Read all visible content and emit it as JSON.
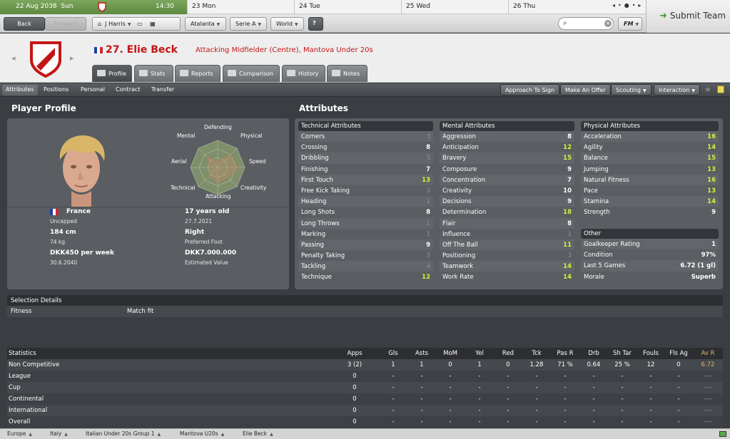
{
  "calendar": {
    "today_date": "22 Aug 2038",
    "today_day": "Sun",
    "time": "14:30",
    "days": [
      {
        "date": "23",
        "day": "Mon"
      },
      {
        "date": "24",
        "day": "Tue"
      },
      {
        "date": "25",
        "day": "Wed"
      },
      {
        "date": "26",
        "day": "Thu"
      }
    ]
  },
  "submit_team": "Submit Team",
  "nav": {
    "back": "Back",
    "forward": "Forward",
    "manager": "J Harris",
    "club": "Atalanta",
    "league": "Serie A",
    "world": "World",
    "fm": "FM"
  },
  "player": {
    "number_name": "27. Elie Beck",
    "role": "Attacking Midfielder (Centre), Mantova Under 20s",
    "header_tabs": [
      "Profile",
      "Stats",
      "Reports",
      "Comparison",
      "History",
      "Notes"
    ]
  },
  "subtabs": [
    "Attributes",
    "Positions",
    "Personal",
    "Contract",
    "Transfer"
  ],
  "actions": {
    "approach": "Approach To Sign",
    "offer": "Make An Offer",
    "scouting": "Scouting",
    "interaction": "Interaction"
  },
  "profile": {
    "title": "Player Profile",
    "nationality": "France",
    "caps": "Uncapped",
    "age": "17 years old",
    "dob": "27.7.2021",
    "height": "184 cm",
    "weight": "74 kg",
    "foot": "Right",
    "foot_label": "Preferred Foot",
    "wage": "DKK450 per week",
    "contract_end": "30.6.2040",
    "value": "DKK7.000.000",
    "value_label": "Estimated Value",
    "radar": {
      "defending": "Defending",
      "physical": "Physical",
      "speed": "Speed",
      "creativity": "Creativity",
      "attacking": "Attacking",
      "technical": "Technical",
      "aerial": "Aerial",
      "mental": "Mental"
    }
  },
  "attributes": {
    "title": "Attributes",
    "technical": {
      "header": "Technical Attributes",
      "rows": [
        [
          "Corners",
          "3"
        ],
        [
          "Crossing",
          "8"
        ],
        [
          "Dribbling",
          "5"
        ],
        [
          "Finishing",
          "7"
        ],
        [
          "First Touch",
          "13"
        ],
        [
          "Free Kick Taking",
          "3"
        ],
        [
          "Heading",
          "1"
        ],
        [
          "Long Shots",
          "8"
        ],
        [
          "Long Throws",
          "1"
        ],
        [
          "Marking",
          "1"
        ],
        [
          "Passing",
          "9"
        ],
        [
          "Penalty Taking",
          "5"
        ],
        [
          "Tackling",
          "4"
        ],
        [
          "Technique",
          "12"
        ]
      ]
    },
    "mental": {
      "header": "Mental Attributes",
      "rows": [
        [
          "Aggression",
          "8"
        ],
        [
          "Anticipation",
          "12"
        ],
        [
          "Bravery",
          "15"
        ],
        [
          "Composure",
          "9"
        ],
        [
          "Concentration",
          "7"
        ],
        [
          "Creativity",
          "10"
        ],
        [
          "Decisions",
          "9"
        ],
        [
          "Determination",
          "18"
        ],
        [
          "Flair",
          "8"
        ],
        [
          "Influence",
          "1"
        ],
        [
          "Off The Ball",
          "11"
        ],
        [
          "Positioning",
          "3"
        ],
        [
          "Teamwork",
          "14"
        ],
        [
          "Work Rate",
          "14"
        ]
      ]
    },
    "physical": {
      "header": "Physical Attributes",
      "rows": [
        [
          "Acceleration",
          "16"
        ],
        [
          "Agility",
          "14"
        ],
        [
          "Balance",
          "15"
        ],
        [
          "Jumping",
          "13"
        ],
        [
          "Natural Fitness",
          "16"
        ],
        [
          "Pace",
          "13"
        ],
        [
          "Stamina",
          "14"
        ],
        [
          "Strength",
          "9"
        ]
      ]
    },
    "other": {
      "header": "Other",
      "rows": [
        [
          "Goalkeeper Rating",
          "1"
        ],
        [
          "Condition",
          "97%"
        ],
        [
          "Last 5 Games",
          "6.72 (1 gl)"
        ],
        [
          "Morale",
          "Superb"
        ]
      ]
    }
  },
  "selection": {
    "title": "Selection Details",
    "fitness_label": "Fitness",
    "fitness_value": "Match fit"
  },
  "stats": {
    "headers": [
      "Statistics",
      "Apps",
      "Gls",
      "Asts",
      "MoM",
      "Yel",
      "Red",
      "Tck",
      "Pas R",
      "Drb",
      "Sh Tar",
      "Fouls",
      "Fls Ag",
      "Av R"
    ],
    "rows": [
      [
        "Non Competitive",
        "3 (2)",
        "1",
        "1",
        "0",
        "1",
        "0",
        "1.28",
        "71 %",
        "0.64",
        "25 %",
        "12",
        "0",
        "6.72"
      ],
      [
        "League",
        "0",
        "-",
        "-",
        "-",
        "-",
        "-",
        "-",
        "-",
        "-",
        "-",
        "-",
        "-",
        "----"
      ],
      [
        "Cup",
        "0",
        "-",
        "-",
        "-",
        "-",
        "-",
        "-",
        "-",
        "-",
        "-",
        "-",
        "-",
        "----"
      ],
      [
        "Continental",
        "0",
        "-",
        "-",
        "-",
        "-",
        "-",
        "-",
        "-",
        "-",
        "-",
        "-",
        "-",
        "----"
      ],
      [
        "International",
        "0",
        "-",
        "-",
        "-",
        "-",
        "-",
        "-",
        "-",
        "-",
        "-",
        "-",
        "-",
        "----"
      ],
      [
        "Overall",
        "0",
        "-",
        "-",
        "-",
        "-",
        "-",
        "-",
        "-",
        "-",
        "-",
        "-",
        "-",
        "----"
      ]
    ]
  },
  "breadcrumbs": [
    "Europe",
    "Italy",
    "Italian Under 20s Group 1",
    "Mantova U20s",
    "Elie Beck"
  ],
  "colors": {
    "accent_red": "#c41515",
    "high_attribute": "#d6f03a",
    "low_attribute": "#8d9095",
    "calendar_green": "#6a9a4c"
  }
}
